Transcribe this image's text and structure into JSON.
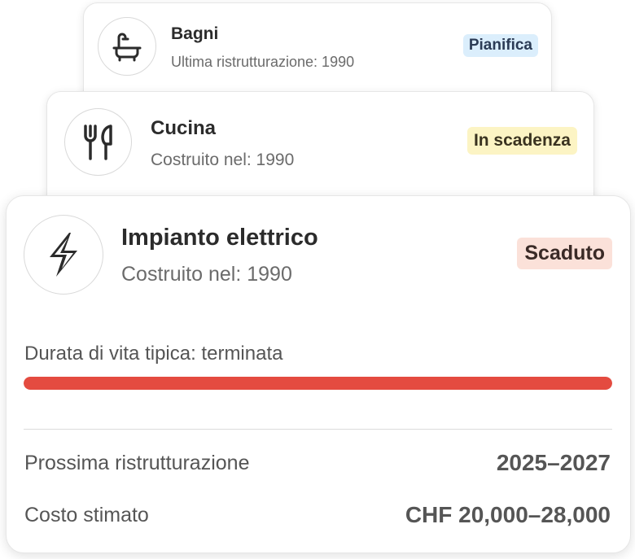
{
  "cards": {
    "bagni": {
      "icon": "bathtub-icon",
      "title": "Bagni",
      "subtitle": "Ultima ristrutturazione: 1990",
      "badge": "Pianifica",
      "badge_color": "#dbeefc"
    },
    "cucina": {
      "icon": "fork-knife-icon",
      "title": "Cucina",
      "subtitle": "Costruito nel: 1990",
      "badge": "In scadenza",
      "badge_color": "#fcf4c4"
    },
    "main": {
      "icon": "lightning-bolt-icon",
      "title": "Impianto elettrico",
      "subtitle": "Costruito nel: 1990",
      "badge": "Scaduto",
      "badge_color": "#fbe1d9",
      "lifetime_label": "Durata di vita tipica: terminata",
      "lifetime_progress": 1.0,
      "lifetime_color": "#e44b40",
      "rows": [
        {
          "label": "Prossima ristrutturazione",
          "value": "2025–2027"
        },
        {
          "label": "Costo stimato",
          "value": "CHF 20,000–28,000"
        }
      ]
    }
  }
}
